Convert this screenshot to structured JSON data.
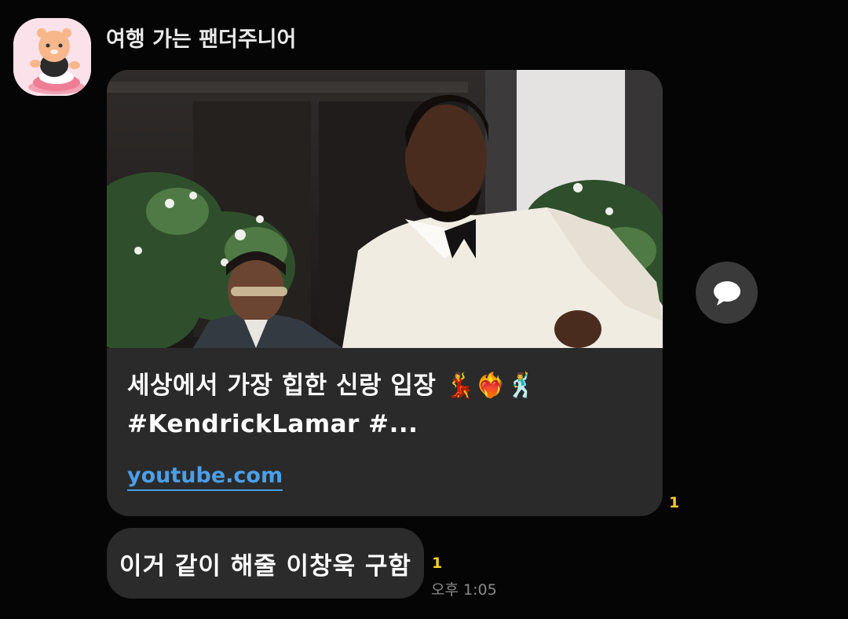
{
  "chat": {
    "sender_name": "여행 가는 팬더주니어",
    "avatar_icon": "panda-character-avatar",
    "accent_unread_color": "#f5cf2a"
  },
  "link_preview": {
    "thumbnail": "video-thumbnail",
    "title_line1": "세상에서 가장 힙한 신랑 입장 💃❤️‍🔥🕺",
    "title_line2": "#KendrickLamar #...",
    "domain": "youtube.com",
    "unread_count": "1"
  },
  "share_button": {
    "icon": "speech-bubble-icon"
  },
  "message": {
    "text": "이거 같이 해줄 이창욱 구함",
    "unread_count": "1",
    "time": "오후 1:05"
  }
}
